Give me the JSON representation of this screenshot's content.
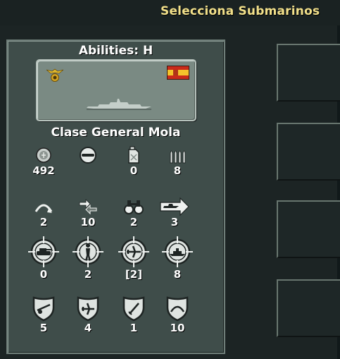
{
  "header": {
    "title": "Selecciona Submarinos"
  },
  "panel": {
    "abilities_title": "Abilities: H",
    "unit_name": "Clase General Mola",
    "insignia_icon": "eagle-emblem-icon",
    "flag_icon": "spain-flag-icon",
    "unit_image": "destroyer-silhouette"
  },
  "stats": {
    "row1": [
      {
        "icon": "coin-icon",
        "value": "492"
      },
      {
        "icon": "submarine-class-icon",
        "value": ""
      },
      {
        "icon": "fuel-canister-icon",
        "value": "0"
      },
      {
        "icon": "ammo-icon",
        "value": "8"
      }
    ],
    "row2": [
      {
        "icon": "movement-arc-icon",
        "value": "2"
      },
      {
        "icon": "move-arrows-icon",
        "value": "10"
      },
      {
        "icon": "binoculars-icon",
        "value": "2"
      },
      {
        "icon": "naval-move-icon",
        "value": "3"
      }
    ],
    "row3": [
      {
        "icon": "target-tank-icon",
        "value": "0"
      },
      {
        "icon": "target-infantry-icon",
        "value": "2"
      },
      {
        "icon": "target-aircraft-icon",
        "value": "[2]"
      },
      {
        "icon": "target-ship-icon",
        "value": "8"
      }
    ],
    "row4": [
      {
        "icon": "defense-artillery-icon",
        "value": "5"
      },
      {
        "icon": "defense-aircraft-icon",
        "value": "4"
      },
      {
        "icon": "defense-close-icon",
        "value": "1"
      },
      {
        "icon": "defense-indirect-icon",
        "value": "10"
      }
    ]
  },
  "colors": {
    "panel": "#3f4d4a",
    "title_yellow": "#f2e08a",
    "background": "#1c2424"
  }
}
